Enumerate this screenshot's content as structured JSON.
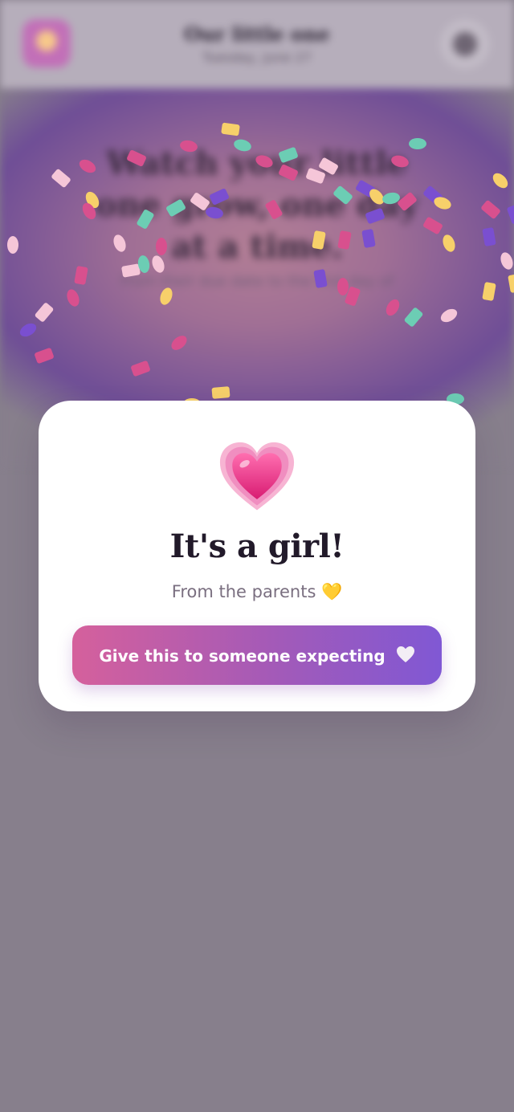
{
  "app_bar": {
    "title": "Our little one",
    "date": "Tuesday, June 27",
    "logo_icon": "app-logo-icon",
    "settings_icon": "settings-icon"
  },
  "hero": {
    "heading": "Watch your little one grow, one day at a time.",
    "subtitle": "From their due date to the first day of"
  },
  "modal": {
    "icon": "growing-heart-icon",
    "title": "It's a girl!",
    "subtitle": "From the parents 💛",
    "button_label": "Give this to someone expecting",
    "button_icon": "white-heart-icon"
  },
  "colors": {
    "button_gradient_start": "#d5609c",
    "button_gradient_end": "#8058d4",
    "heart": "#e8388f",
    "confetti": [
      "#f7d06a",
      "#6ccdb4",
      "#d8508e",
      "#7a4fd0",
      "#f5c6d8"
    ]
  }
}
